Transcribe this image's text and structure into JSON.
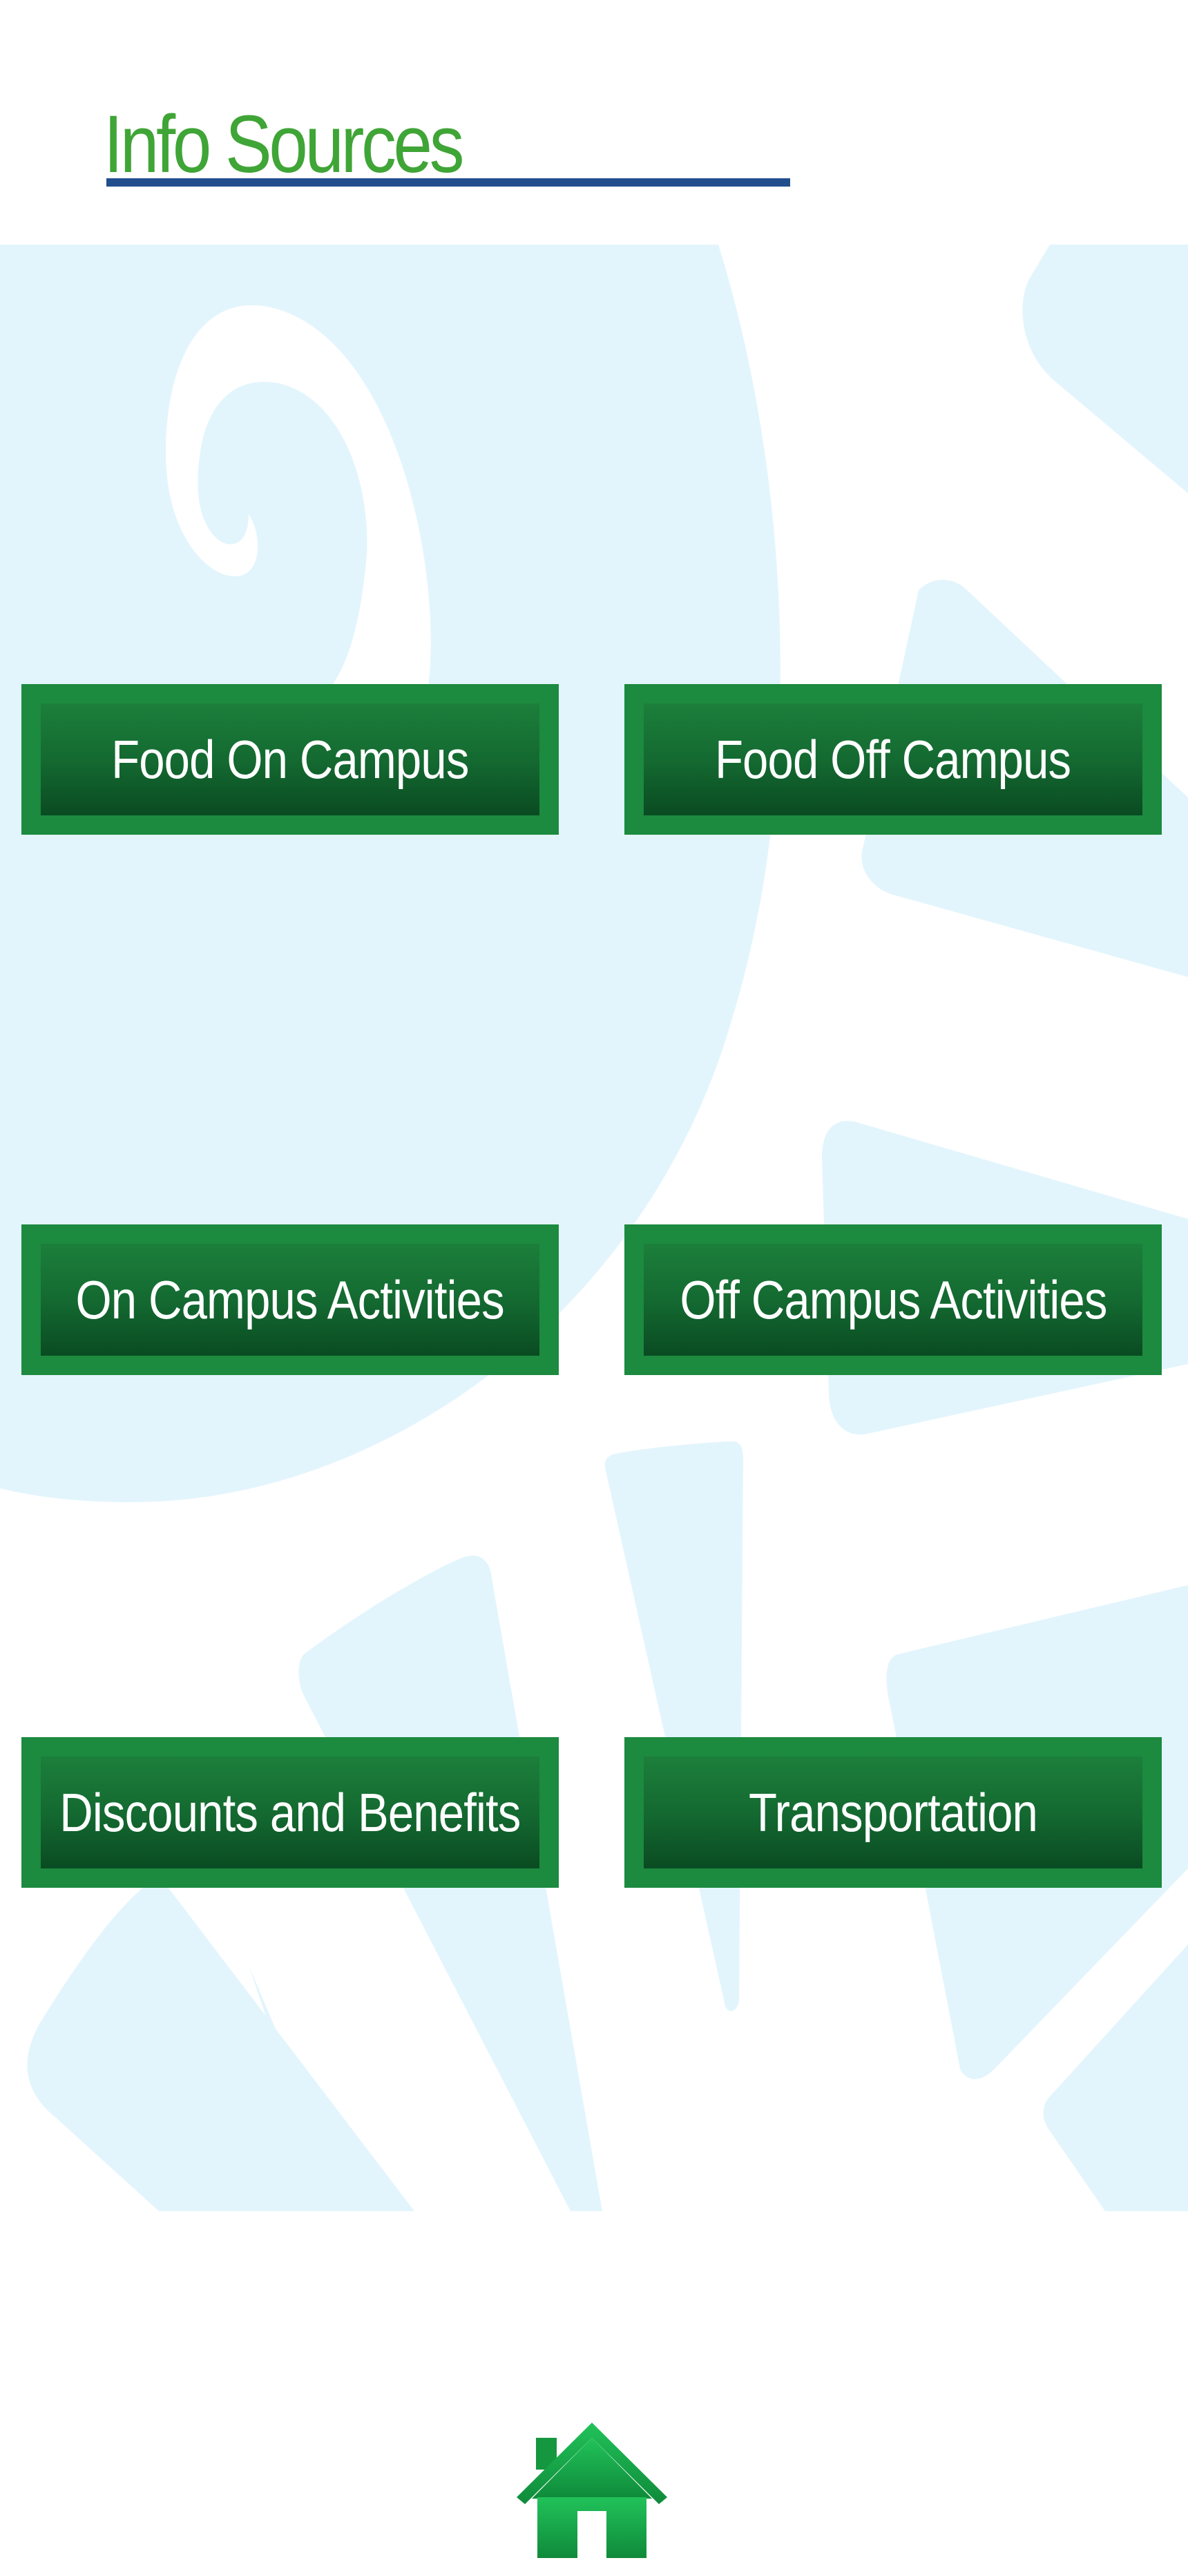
{
  "header": {
    "title": "Info Sources"
  },
  "buttons": [
    {
      "label": "Food On Campus"
    },
    {
      "label": "Food Off Campus"
    },
    {
      "label": "On Campus Activities"
    },
    {
      "label": "Off Campus Activities"
    },
    {
      "label": "Discounts and Benefits"
    },
    {
      "label": "Transportation"
    }
  ],
  "footer": {
    "home_icon": "home-icon"
  },
  "colors": {
    "title": "#3fa536",
    "underline": "#214f8e",
    "button_border": "#1c8a3f",
    "button_fill_top": "#1c7f3b",
    "button_fill_bottom": "#0a4b22",
    "background_art": "#e3f5fc",
    "home_icon": "#1aa648"
  }
}
